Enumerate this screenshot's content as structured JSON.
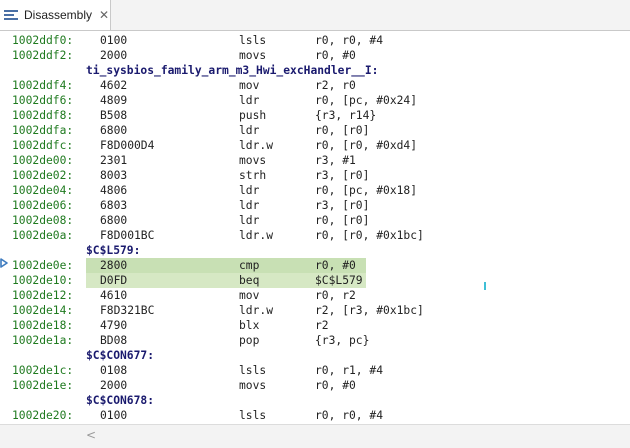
{
  "tab": {
    "title": "Disassembly",
    "close": "✕"
  },
  "lines": [
    {
      "kind": "ins",
      "addr": "1002ddf0:",
      "op": "0100",
      "mn": "lsls",
      "args": "r0, r0, #4"
    },
    {
      "kind": "ins",
      "addr": "1002ddf2:",
      "op": "2000",
      "mn": "movs",
      "args": "r0, #0"
    },
    {
      "kind": "label",
      "text": "ti_sysbios_family_arm_m3_Hwi_excHandler__I:"
    },
    {
      "kind": "ins",
      "addr": "1002ddf4:",
      "op": "4602",
      "mn": "mov",
      "args": "r2, r0"
    },
    {
      "kind": "ins",
      "addr": "1002ddf6:",
      "op": "4809",
      "mn": "ldr",
      "args": "r0, [pc, #0x24]"
    },
    {
      "kind": "ins",
      "addr": "1002ddf8:",
      "op": "B508",
      "mn": "push",
      "args": "{r3, r14}"
    },
    {
      "kind": "ins",
      "addr": "1002ddfa:",
      "op": "6800",
      "mn": "ldr",
      "args": "r0, [r0]"
    },
    {
      "kind": "ins",
      "addr": "1002ddfc:",
      "op": "F8D000D4",
      "mn": "ldr.w",
      "args": "r0, [r0, #0xd4]"
    },
    {
      "kind": "ins",
      "addr": "1002de00:",
      "op": "2301",
      "mn": "movs",
      "args": "r3, #1"
    },
    {
      "kind": "ins",
      "addr": "1002de02:",
      "op": "8003",
      "mn": "strh",
      "args": "r3, [r0]"
    },
    {
      "kind": "ins",
      "addr": "1002de04:",
      "op": "4806",
      "mn": "ldr",
      "args": "r0, [pc, #0x18]"
    },
    {
      "kind": "ins",
      "addr": "1002de06:",
      "op": "6803",
      "mn": "ldr",
      "args": "r3, [r0]"
    },
    {
      "kind": "ins",
      "addr": "1002de08:",
      "op": "6800",
      "mn": "ldr",
      "args": "r0, [r0]"
    },
    {
      "kind": "ins",
      "addr": "1002de0a:",
      "op": "F8D001BC",
      "mn": "ldr.w",
      "args": "r0, [r0, #0x1bc]"
    },
    {
      "kind": "label",
      "text": "$C$L579:"
    },
    {
      "kind": "ins",
      "addr": "1002de0e:",
      "op": "2800",
      "mn": "cmp",
      "args": "r0, #0",
      "highlight": "current"
    },
    {
      "kind": "ins",
      "addr": "1002de10:",
      "op": "D0FD",
      "mn": "beq",
      "args": "$C$L579",
      "highlight": "yes"
    },
    {
      "kind": "ins",
      "addr": "1002de12:",
      "op": "4610",
      "mn": "mov",
      "args": "r0, r2"
    },
    {
      "kind": "ins",
      "addr": "1002de14:",
      "op": "F8D321BC",
      "mn": "ldr.w",
      "args": "r2, [r3, #0x1bc]"
    },
    {
      "kind": "ins",
      "addr": "1002de18:",
      "op": "4790",
      "mn": "blx",
      "args": "r2"
    },
    {
      "kind": "ins",
      "addr": "1002de1a:",
      "op": "BD08",
      "mn": "pop",
      "args": "{r3, pc}"
    },
    {
      "kind": "label",
      "text": "$C$CON677:"
    },
    {
      "kind": "ins",
      "addr": "1002de1c:",
      "op": "0108",
      "mn": "lsls",
      "args": "r0, r1, #4"
    },
    {
      "kind": "ins",
      "addr": "1002de1e:",
      "op": "2000",
      "mn": "movs",
      "args": "r0, #0"
    },
    {
      "kind": "label",
      "text": "$C$CON678:"
    },
    {
      "kind": "ins",
      "addr": "1002de20:",
      "op": "0100",
      "mn": "lsls",
      "args": "r0, r0, #4"
    }
  ],
  "icons": {
    "tab": "disassembly-view-icon",
    "pc": "program-counter-arrow-icon",
    "scroll": "scroll-left-arrow-icon"
  },
  "scroll": {
    "left_arrow": "<"
  }
}
